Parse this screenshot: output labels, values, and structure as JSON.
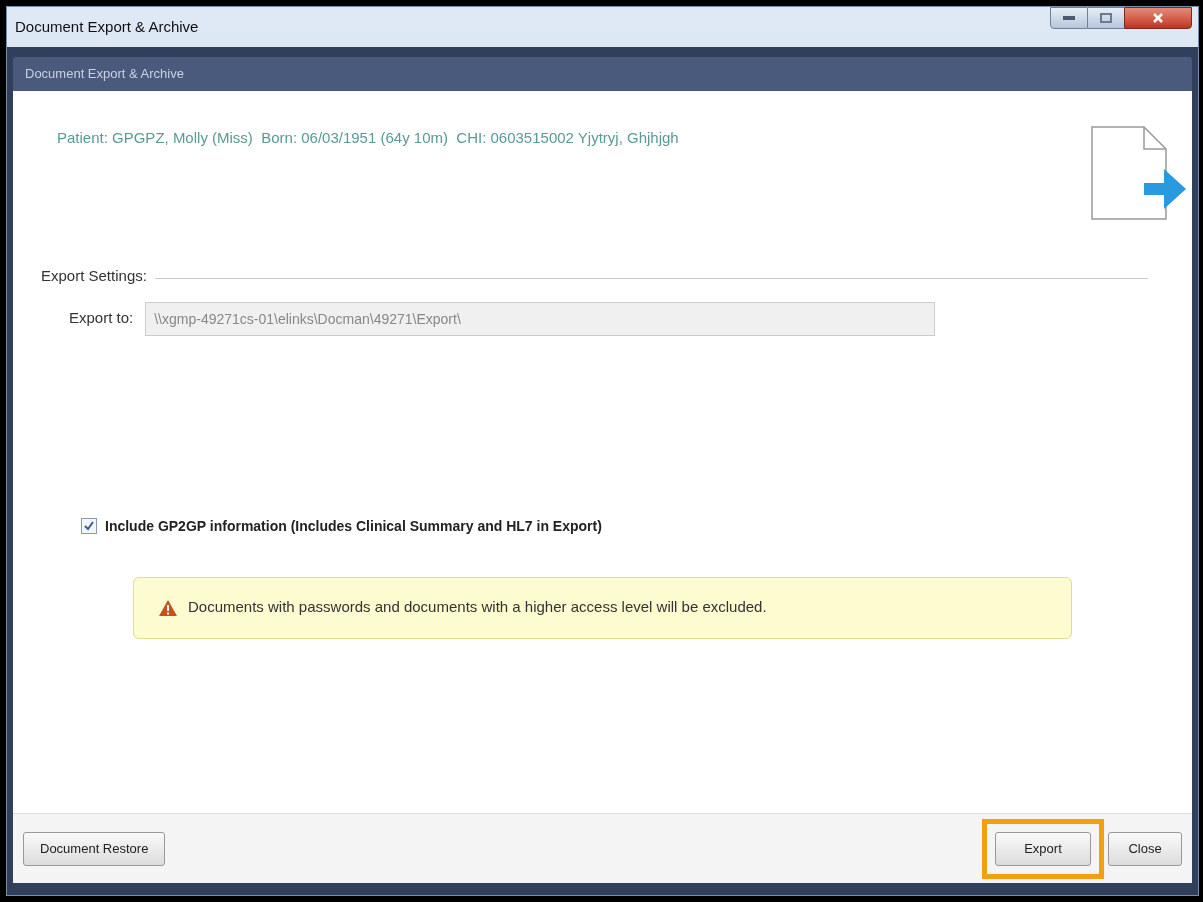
{
  "window": {
    "title": "Document Export & Archive"
  },
  "panel": {
    "title": "Document Export & Archive"
  },
  "patient_line": "Patient: GPGPZ, Molly (Miss)  Born: 06/03/1951 (64y 10m)  CHI: 0603515002 Yjytryj, Ghjhjgh",
  "export_settings": {
    "heading": "Export Settings:",
    "label": "Export to:",
    "value": "\\\\xgmp-49271cs-01\\elinks\\Docman\\49271\\Export\\",
    "disabled": true
  },
  "checkbox": {
    "label": "Include GP2GP information (Includes Clinical Summary and HL7 in Export)",
    "checked": true
  },
  "warning": "Documents with passwords and documents with a higher access level will be excluded.",
  "buttons": [
    {
      "label": "Document Restore",
      "highlighted": false
    },
    {
      "label": "Export",
      "highlighted": true
    },
    {
      "label": "Close",
      "highlighted": false
    }
  ]
}
